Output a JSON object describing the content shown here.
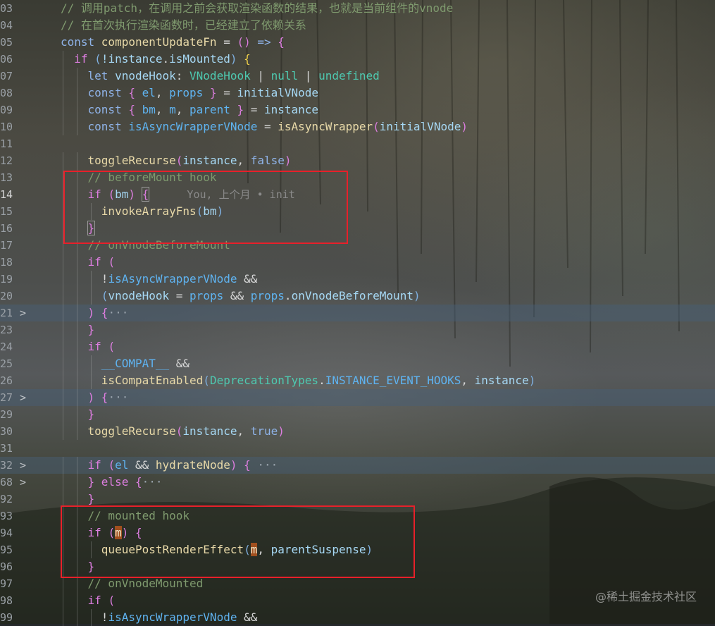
{
  "editor": {
    "lines": [
      {
        "num": "03",
        "tokens": [
          {
            "text": "// 调用patch，在调用之前会获取渲染函数的结果，也就是当前组件的vnode",
            "cls": "c"
          }
        ]
      },
      {
        "num": "04",
        "tokens": [
          {
            "text": "// 在首次执行渲染函数时，已经建立了依赖关系",
            "cls": "c"
          }
        ]
      },
      {
        "num": "05",
        "tokens": [
          {
            "text": "const ",
            "cls": "k"
          },
          {
            "text": "componentUpdateFn",
            "cls": "f"
          },
          {
            "text": " = ",
            "cls": "o"
          },
          {
            "text": "()",
            "cls": "p2"
          },
          {
            "text": " => ",
            "cls": "k"
          },
          {
            "text": "{",
            "cls": "p2"
          }
        ]
      },
      {
        "num": "06",
        "tokens": [
          {
            "text": "  if ",
            "cls": "p2"
          },
          {
            "text": "(",
            "cls": "bo"
          },
          {
            "text": "!instance",
            "cls": "v"
          },
          {
            "text": ".",
            "cls": "o"
          },
          {
            "text": "isMounted",
            "cls": "v"
          },
          {
            "text": ") ",
            "cls": "bo"
          },
          {
            "text": "{",
            "cls": "p"
          }
        ]
      },
      {
        "num": "07",
        "tokens": [
          {
            "text": "    let ",
            "cls": "k"
          },
          {
            "text": "vnodeHook",
            "cls": "v"
          },
          {
            "text": ": ",
            "cls": "o"
          },
          {
            "text": "VNodeHook",
            "cls": "t"
          },
          {
            "text": " | ",
            "cls": "o"
          },
          {
            "text": "null",
            "cls": "t"
          },
          {
            "text": " | ",
            "cls": "o"
          },
          {
            "text": "undefined",
            "cls": "t"
          }
        ]
      },
      {
        "num": "08",
        "tokens": [
          {
            "text": "    const ",
            "cls": "k"
          },
          {
            "text": "{ ",
            "cls": "p2"
          },
          {
            "text": "el",
            "cls": "cn"
          },
          {
            "text": ", ",
            "cls": "o"
          },
          {
            "text": "props",
            "cls": "cn"
          },
          {
            "text": " }",
            "cls": "p2"
          },
          {
            "text": " = ",
            "cls": "o"
          },
          {
            "text": "initialVNode",
            "cls": "v"
          }
        ]
      },
      {
        "num": "09",
        "tokens": [
          {
            "text": "    const ",
            "cls": "k"
          },
          {
            "text": "{ ",
            "cls": "p2"
          },
          {
            "text": "bm",
            "cls": "cn"
          },
          {
            "text": ", ",
            "cls": "o"
          },
          {
            "text": "m",
            "cls": "cn"
          },
          {
            "text": ", ",
            "cls": "o"
          },
          {
            "text": "parent",
            "cls": "cn"
          },
          {
            "text": " }",
            "cls": "p2"
          },
          {
            "text": " = ",
            "cls": "o"
          },
          {
            "text": "instance",
            "cls": "v"
          }
        ]
      },
      {
        "num": "10",
        "tokens": [
          {
            "text": "    const ",
            "cls": "k"
          },
          {
            "text": "isAsyncWrapperVNode",
            "cls": "cn"
          },
          {
            "text": " = ",
            "cls": "o"
          },
          {
            "text": "isAsyncWrapper",
            "cls": "f"
          },
          {
            "text": "(",
            "cls": "p2"
          },
          {
            "text": "initialVNode",
            "cls": "v"
          },
          {
            "text": ")",
            "cls": "p2"
          }
        ]
      },
      {
        "num": "11",
        "tokens": []
      },
      {
        "num": "12",
        "tokens": [
          {
            "text": "    ",
            "cls": "o"
          },
          {
            "text": "toggleRecurse",
            "cls": "f"
          },
          {
            "text": "(",
            "cls": "p2"
          },
          {
            "text": "instance",
            "cls": "v"
          },
          {
            "text": ", ",
            "cls": "o"
          },
          {
            "text": "false",
            "cls": "k"
          },
          {
            "text": ")",
            "cls": "p2"
          }
        ]
      },
      {
        "num": "13",
        "tokens": [
          {
            "text": "    // beforeMount hook",
            "cls": "c"
          }
        ]
      },
      {
        "num": "14",
        "active": true,
        "tokens": [
          {
            "text": "    if ",
            "cls": "p2"
          },
          {
            "text": "(",
            "cls": "p2"
          },
          {
            "text": "bm",
            "cls": "v"
          },
          {
            "text": ") ",
            "cls": "p2"
          },
          {
            "text": "{",
            "cls": "p2 hlbox"
          },
          {
            "text": "      You, 上个月 • init",
            "cls": "lens"
          }
        ]
      },
      {
        "num": "15",
        "tokens": [
          {
            "text": "      ",
            "cls": "o"
          },
          {
            "text": "invokeArrayFns",
            "cls": "f"
          },
          {
            "text": "(",
            "cls": "bo"
          },
          {
            "text": "bm",
            "cls": "v"
          },
          {
            "text": ")",
            "cls": "bo"
          }
        ]
      },
      {
        "num": "16",
        "tokens": [
          {
            "text": "    ",
            "cls": "o"
          },
          {
            "text": "}",
            "cls": "p2 hlbox"
          }
        ]
      },
      {
        "num": "17",
        "tokens": [
          {
            "text": "    // onVnodeBeforeMount",
            "cls": "c"
          }
        ]
      },
      {
        "num": "18",
        "tokens": [
          {
            "text": "    if ",
            "cls": "p2"
          },
          {
            "text": "(",
            "cls": "p2"
          }
        ]
      },
      {
        "num": "19",
        "tokens": [
          {
            "text": "      !",
            "cls": "o"
          },
          {
            "text": "isAsyncWrapperVNode",
            "cls": "cn"
          },
          {
            "text": " &&",
            "cls": "o"
          }
        ]
      },
      {
        "num": "20",
        "tokens": [
          {
            "text": "      ",
            "cls": "o"
          },
          {
            "text": "(",
            "cls": "bo"
          },
          {
            "text": "vnodeHook",
            "cls": "v"
          },
          {
            "text": " = ",
            "cls": "o"
          },
          {
            "text": "props",
            "cls": "cn"
          },
          {
            "text": " && ",
            "cls": "o"
          },
          {
            "text": "props",
            "cls": "cn"
          },
          {
            "text": ".",
            "cls": "o"
          },
          {
            "text": "onVnodeBeforeMount",
            "cls": "v"
          },
          {
            "text": ")",
            "cls": "bo"
          }
        ]
      },
      {
        "num": "21",
        "folded": true,
        "fold": ">",
        "tokens": [
          {
            "text": "    ",
            "cls": "o"
          },
          {
            "text": ") {",
            "cls": "p2"
          },
          {
            "text": "···",
            "cls": "ell"
          }
        ]
      },
      {
        "num": "23",
        "tokens": [
          {
            "text": "    ",
            "cls": "o"
          },
          {
            "text": "}",
            "cls": "p2"
          }
        ]
      },
      {
        "num": "24",
        "tokens": [
          {
            "text": "    if ",
            "cls": "p2"
          },
          {
            "text": "(",
            "cls": "p2"
          }
        ]
      },
      {
        "num": "25",
        "tokens": [
          {
            "text": "      __COMPAT__",
            "cls": "cn"
          },
          {
            "text": " &&",
            "cls": "o"
          }
        ]
      },
      {
        "num": "26",
        "tokens": [
          {
            "text": "      ",
            "cls": "o"
          },
          {
            "text": "isCompatEnabled",
            "cls": "f"
          },
          {
            "text": "(",
            "cls": "bo"
          },
          {
            "text": "DeprecationTypes",
            "cls": "t"
          },
          {
            "text": ".",
            "cls": "o"
          },
          {
            "text": "INSTANCE_EVENT_HOOKS",
            "cls": "cn"
          },
          {
            "text": ", ",
            "cls": "o"
          },
          {
            "text": "instance",
            "cls": "v"
          },
          {
            "text": ")",
            "cls": "bo"
          }
        ]
      },
      {
        "num": "27",
        "folded": true,
        "fold": ">",
        "tokens": [
          {
            "text": "    ",
            "cls": "o"
          },
          {
            "text": ") {",
            "cls": "p2"
          },
          {
            "text": "···",
            "cls": "ell"
          }
        ]
      },
      {
        "num": "29",
        "tokens": [
          {
            "text": "    ",
            "cls": "o"
          },
          {
            "text": "}",
            "cls": "p2"
          }
        ]
      },
      {
        "num": "30",
        "tokens": [
          {
            "text": "    ",
            "cls": "o"
          },
          {
            "text": "toggleRecurse",
            "cls": "f"
          },
          {
            "text": "(",
            "cls": "p2"
          },
          {
            "text": "instance",
            "cls": "v"
          },
          {
            "text": ", ",
            "cls": "o"
          },
          {
            "text": "true",
            "cls": "k"
          },
          {
            "text": ")",
            "cls": "p2"
          }
        ]
      },
      {
        "num": "31",
        "tokens": []
      },
      {
        "num": "32",
        "folded": true,
        "fold": ">",
        "tokens": [
          {
            "text": "    if ",
            "cls": "p2"
          },
          {
            "text": "(",
            "cls": "p2"
          },
          {
            "text": "el",
            "cls": "cn"
          },
          {
            "text": " && ",
            "cls": "o"
          },
          {
            "text": "hydrateNode",
            "cls": "f"
          },
          {
            "text": ") ",
            "cls": "p2"
          },
          {
            "text": "{",
            "cls": "p2"
          },
          {
            "text": " ···",
            "cls": "ell"
          }
        ]
      },
      {
        "num": "68",
        "fold": ">",
        "tokens": [
          {
            "text": "    ",
            "cls": "o"
          },
          {
            "text": "} ",
            "cls": "p2"
          },
          {
            "text": "else ",
            "cls": "p2"
          },
          {
            "text": "{",
            "cls": "p2"
          },
          {
            "text": "···",
            "cls": "ell"
          }
        ]
      },
      {
        "num": "92",
        "tokens": [
          {
            "text": "    ",
            "cls": "o"
          },
          {
            "text": "}",
            "cls": "p2"
          }
        ]
      },
      {
        "num": "93",
        "tokens": [
          {
            "text": "    // mounted hook",
            "cls": "c"
          }
        ]
      },
      {
        "num": "94",
        "tokens": [
          {
            "text": "    if ",
            "cls": "p2"
          },
          {
            "text": "(",
            "cls": "p2"
          },
          {
            "text": "m",
            "cls": "v hl"
          },
          {
            "text": ") ",
            "cls": "p2"
          },
          {
            "text": "{",
            "cls": "p2"
          }
        ]
      },
      {
        "num": "95",
        "tokens": [
          {
            "text": "      ",
            "cls": "o"
          },
          {
            "text": "queuePostRenderEffect",
            "cls": "f"
          },
          {
            "text": "(",
            "cls": "bo"
          },
          {
            "text": "m",
            "cls": "v hl"
          },
          {
            "text": ", ",
            "cls": "o"
          },
          {
            "text": "parentSuspense",
            "cls": "v"
          },
          {
            "text": ")",
            "cls": "bo"
          }
        ]
      },
      {
        "num": "96",
        "tokens": [
          {
            "text": "    ",
            "cls": "o"
          },
          {
            "text": "}",
            "cls": "p2"
          }
        ]
      },
      {
        "num": "97",
        "tokens": [
          {
            "text": "    // onVnodeMounted",
            "cls": "c"
          }
        ]
      },
      {
        "num": "98",
        "tokens": [
          {
            "text": "    if ",
            "cls": "p2"
          },
          {
            "text": "(",
            "cls": "p2"
          }
        ]
      },
      {
        "num": "99",
        "tokens": [
          {
            "text": "      !",
            "cls": "o"
          },
          {
            "text": "isAsyncWrapperVNode",
            "cls": "cn"
          },
          {
            "text": " &&",
            "cls": "o"
          }
        ]
      }
    ]
  },
  "watermark": "@稀土掘金技术社区",
  "colors": {
    "highlight_box": "#e8202a",
    "fold_highlight": "#465f78"
  }
}
